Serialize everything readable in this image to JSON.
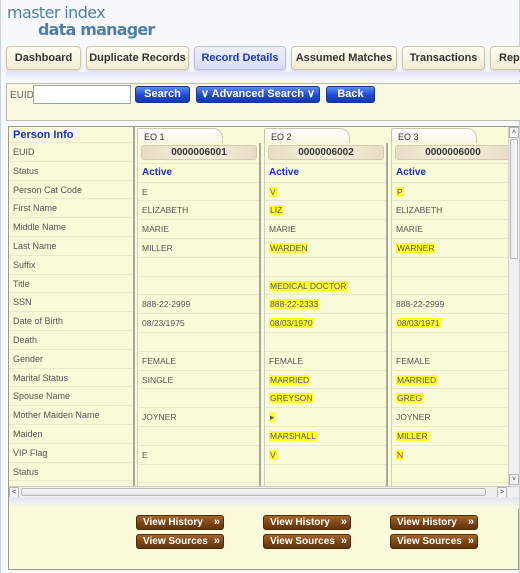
{
  "app": {
    "logo_line1": "master index",
    "logo_line2": "data manager"
  },
  "nav": {
    "tabs": [
      {
        "label": "Dashboard",
        "active": false
      },
      {
        "label": "Duplicate Records",
        "active": false
      },
      {
        "label": "Record Details",
        "active": true
      },
      {
        "label": "Assumed Matches",
        "active": false
      },
      {
        "label": "Transactions",
        "active": false
      },
      {
        "label": "Repo",
        "active": false
      }
    ]
  },
  "search": {
    "euid_label": "EUID",
    "euid_value": "",
    "search_label": "Search",
    "advanced_label": "∨ Advanced Search ∨",
    "back_label": "Back"
  },
  "person_info": {
    "header": "Person Info",
    "fields": [
      "EUID",
      "Status",
      "Person Cat Code",
      "First Name",
      "Middle Name",
      "Last Name",
      "Suffix",
      "Title",
      "SSN",
      "Date of Birth",
      "Death",
      "Gender",
      "Marital Status",
      "Spouse Name",
      "Mother Maiden Name",
      "Maiden",
      "VIP Flag",
      "Status"
    ]
  },
  "records": [
    {
      "tab": "EO 1",
      "euid": "0000006001",
      "status": "Active",
      "values": [
        {
          "v": "E",
          "hl": false
        },
        {
          "v": "ELIZABETH",
          "hl": false
        },
        {
          "v": "MARIE",
          "hl": false
        },
        {
          "v": "MILLER",
          "hl": false
        },
        {
          "v": "",
          "hl": false
        },
        {
          "v": "",
          "hl": false
        },
        {
          "v": "888-22-2999",
          "hl": false
        },
        {
          "v": "08/23/1975",
          "hl": false
        },
        {
          "v": "",
          "hl": false
        },
        {
          "v": "FEMALE",
          "hl": false
        },
        {
          "v": "SINGLE",
          "hl": false
        },
        {
          "v": "",
          "hl": false
        },
        {
          "v": "JOYNER",
          "hl": false
        },
        {
          "v": "",
          "hl": false
        },
        {
          "v": "E",
          "hl": false
        },
        {
          "v": "",
          "hl": false
        }
      ],
      "view_history": "View History",
      "view_sources": "View Sources"
    },
    {
      "tab": "EO 2",
      "euid": "0000006002",
      "status": "Active",
      "values": [
        {
          "v": "V",
          "hl": true
        },
        {
          "v": "LIZ",
          "hl": true
        },
        {
          "v": "MARIE",
          "hl": false
        },
        {
          "v": "WARDEN",
          "hl": true
        },
        {
          "v": "",
          "hl": false
        },
        {
          "v": "MEDICAL DOCTOR",
          "hl": true
        },
        {
          "v": "888-22-2333",
          "hl": true
        },
        {
          "v": "08/03/1970",
          "hl": true
        },
        {
          "v": "",
          "hl": false
        },
        {
          "v": "FEMALE",
          "hl": false
        },
        {
          "v": "MARRIED",
          "hl": true
        },
        {
          "v": "GREYSON",
          "hl": true
        },
        {
          "v": "▸",
          "hl": true
        },
        {
          "v": "MARSHALL",
          "hl": true
        },
        {
          "v": "V",
          "hl": true
        },
        {
          "v": "",
          "hl": false
        }
      ],
      "view_history": "View History",
      "view_sources": "View Sources"
    },
    {
      "tab": "EO 3",
      "euid": "0000006000",
      "status": "Active",
      "values": [
        {
          "v": "P",
          "hl": true
        },
        {
          "v": "ELIZABETH",
          "hl": false
        },
        {
          "v": "MARIE",
          "hl": false
        },
        {
          "v": "WARNER",
          "hl": true
        },
        {
          "v": "",
          "hl": false
        },
        {
          "v": "",
          "hl": false
        },
        {
          "v": "888-22-2999",
          "hl": false
        },
        {
          "v": "08/03/1971",
          "hl": true
        },
        {
          "v": "",
          "hl": false
        },
        {
          "v": "FEMALE",
          "hl": false
        },
        {
          "v": "MARRIED",
          "hl": true
        },
        {
          "v": "GREG",
          "hl": true
        },
        {
          "v": "JOYNER",
          "hl": false
        },
        {
          "v": "MILLER",
          "hl": true
        },
        {
          "v": "N",
          "hl": true
        },
        {
          "v": "",
          "hl": false
        }
      ],
      "view_history": "View History",
      "view_sources": "View Sources"
    }
  ],
  "icons": {
    "chevron_double_right": "»",
    "scroll_up": "˄",
    "scroll_down": "˅",
    "scroll_left": "<",
    "scroll_right": ">"
  },
  "colors": {
    "highlight": "#ffff33",
    "accent_blue": "#1a2fd0",
    "panel_bg": "#f8fad8",
    "brown_button": "#7c4514"
  }
}
